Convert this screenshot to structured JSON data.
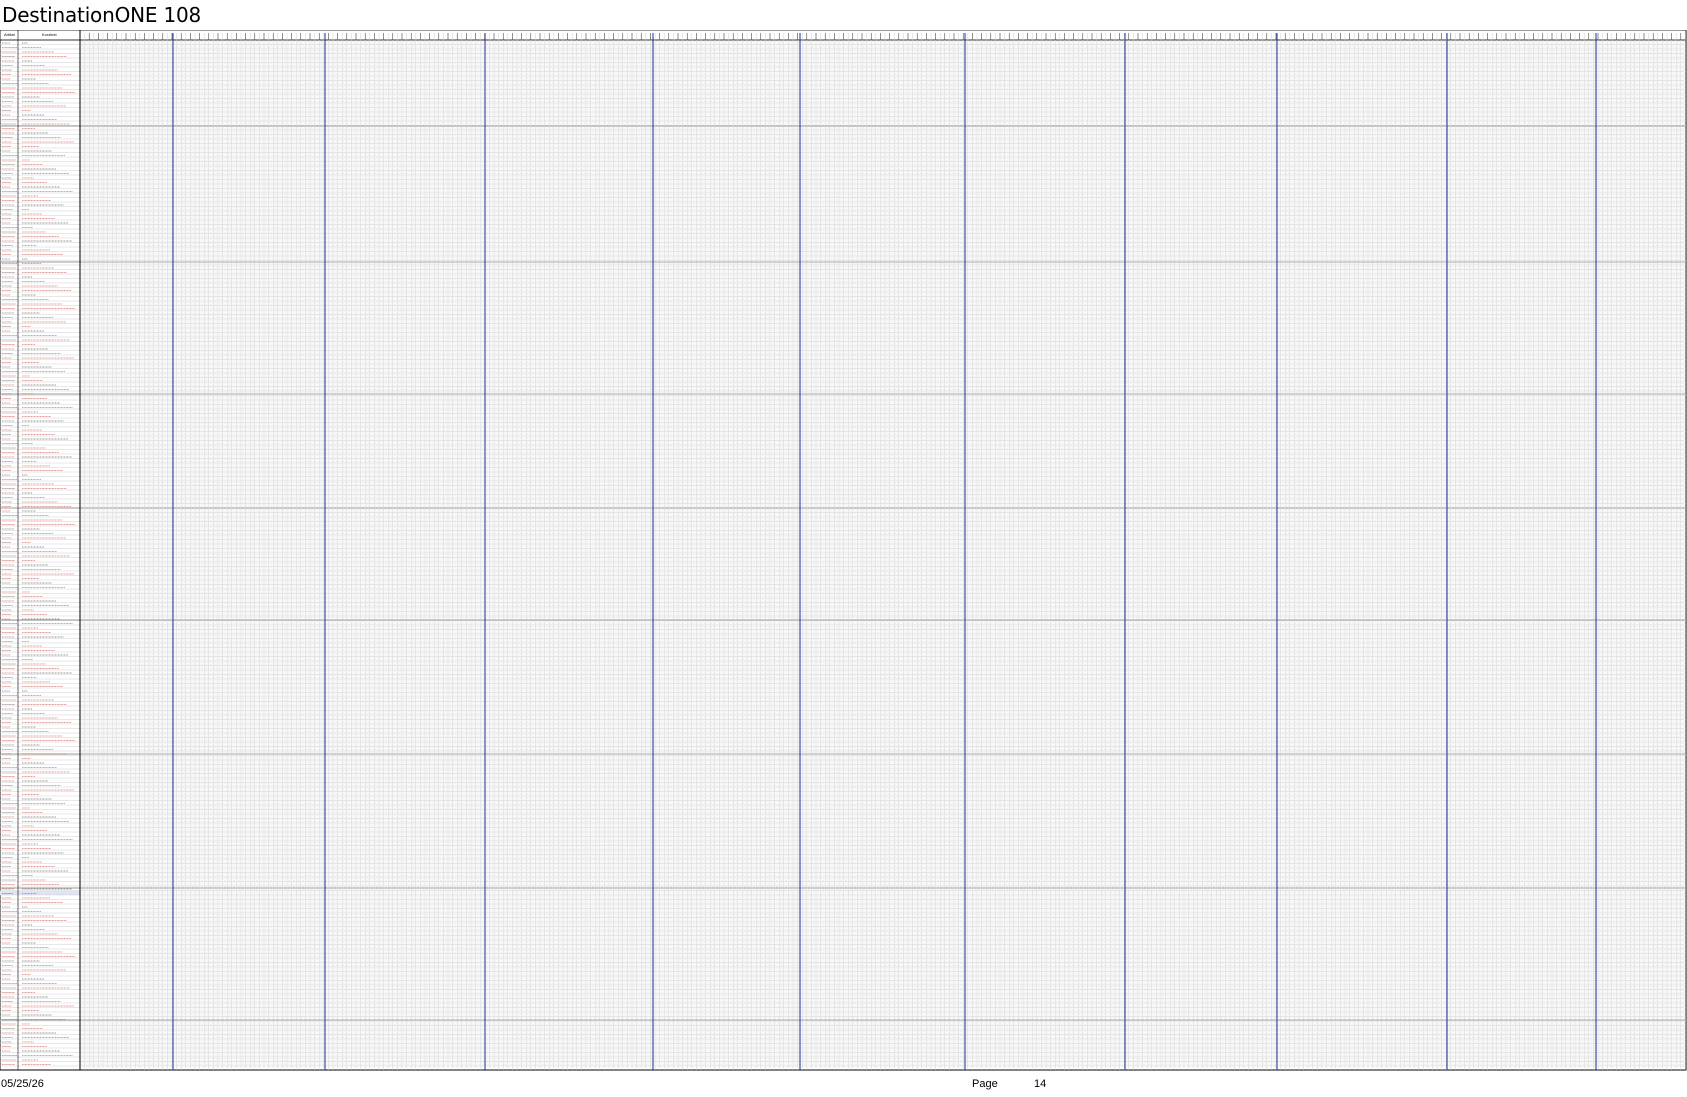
{
  "document": {
    "title": "DestinationONE 108",
    "header": {
      "col1": "Artikel",
      "col2": "Kurztext"
    },
    "footer": {
      "date": "05/25/26",
      "page_label": "Page",
      "page_number": "14"
    }
  },
  "colors": {
    "grid_line": "#9a9a9a",
    "grid_light": "#cfcfcf",
    "separator_blue": "#1f2d9c",
    "code_red": "#c0392b",
    "text_dark": "#000000",
    "section_highlight": "#dfe3f3"
  }
}
